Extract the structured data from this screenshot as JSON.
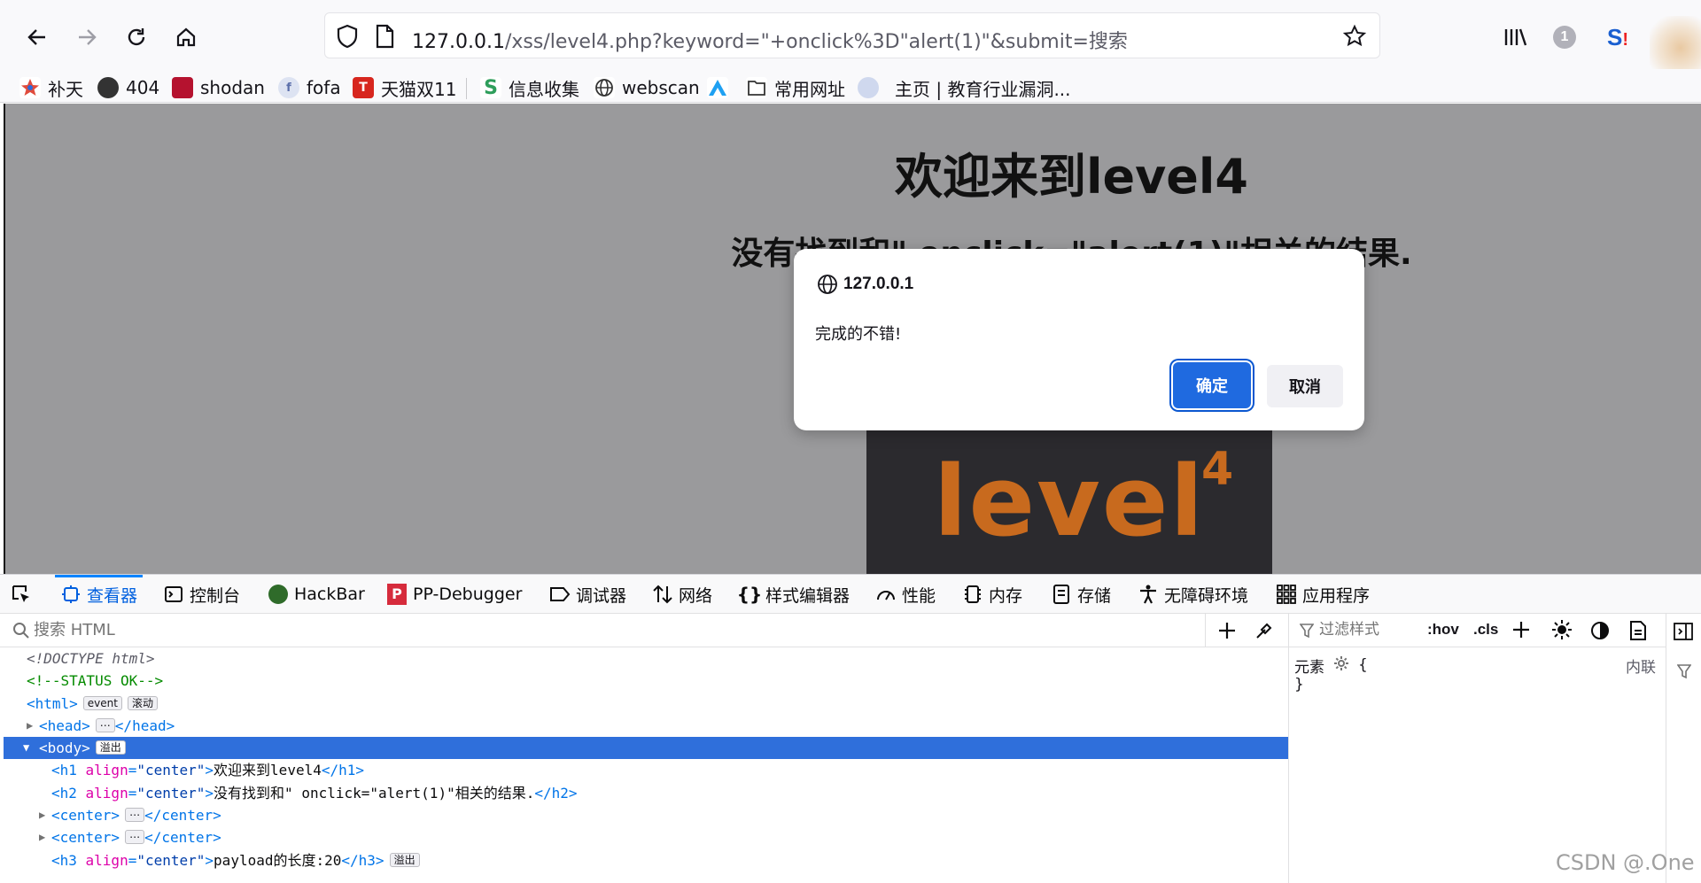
{
  "browser": {
    "url_host": "127.0.0.1",
    "url_path": "/xss/level4.php?keyword=\"+onclick%3D\"alert(1)\"&submit=搜索",
    "bookmarks": [
      {
        "label": "补天",
        "icon": "butian-icon",
        "color": "#d94a38"
      },
      {
        "label": "404",
        "icon": "404-icon",
        "color": "#333333"
      },
      {
        "label": "shodan",
        "icon": "shodan-icon",
        "color": "#b5122f"
      },
      {
        "label": "fofa",
        "icon": "fofa-icon",
        "color": "#5a6eaa"
      },
      {
        "label": "天猫双11",
        "icon": "tmall-icon",
        "color": "#d7261e"
      },
      {
        "label": "信息收集",
        "icon": "info-collect-icon",
        "color": "#2e9e5b"
      },
      {
        "label": "webscan",
        "icon": "globe-icon",
        "color": "#333333"
      },
      {
        "label": "",
        "icon": "triangle-icon",
        "color": "#1ea0f2"
      },
      {
        "label": "常用网址",
        "icon": "folder-icon",
        "color": "#333333"
      },
      {
        "label": "主页 | 教育行业漏洞...",
        "icon": "edusrc-icon",
        "color": "#6c86c9"
      }
    ]
  },
  "page": {
    "h1": "欢迎来到level4",
    "h2": "没有找到和\" onclick=\"alert(1)\"相关的结果.",
    "image_text": "level",
    "image_sup": "4"
  },
  "dialog": {
    "origin": "127.0.0.1",
    "message": "完成的不错!",
    "ok_label": "确定",
    "cancel_label": "取消"
  },
  "devtools": {
    "tabs": [
      {
        "label": "查看器",
        "icon": "inspector-icon"
      },
      {
        "label": "控制台",
        "icon": "console-icon"
      },
      {
        "label": "HackBar",
        "icon": "hackbar-icon"
      },
      {
        "label": "PP-Debugger",
        "icon": "ppdebugger-icon"
      },
      {
        "label": "调试器",
        "icon": "debugger-icon"
      },
      {
        "label": "网络",
        "icon": "network-icon"
      },
      {
        "label": "样式编辑器",
        "icon": "style-editor-icon"
      },
      {
        "label": "性能",
        "icon": "performance-icon"
      },
      {
        "label": "内存",
        "icon": "memory-icon"
      },
      {
        "label": "存储",
        "icon": "storage-icon"
      },
      {
        "label": "无障碍环境",
        "icon": "accessibility-icon"
      },
      {
        "label": "应用程序",
        "icon": "application-icon"
      }
    ],
    "search_placeholder": "搜索 HTML",
    "filter_placeholder": "过滤样式",
    "hov": ":hov",
    "cls": ".cls",
    "element_label": "元素",
    "brace_open": "{",
    "brace_close": "}",
    "inline_label": "内联",
    "markup": {
      "doctype": "<!DOCTYPE html>",
      "comment": "<!--STATUS OK-->",
      "html_tag": "<html>",
      "badge_event": "event",
      "badge_scroll": "滚动",
      "head_open": "<head>",
      "head_close": "</head>",
      "body_tag": "<body>",
      "badge_overflow": "溢出",
      "h1_attr": "align",
      "h1_val": "\"center\"",
      "h1_text": "欢迎来到level4",
      "h2_text": "没有找到和\" onclick=\"alert(1)\"相关的结果.",
      "center_open": "<center>",
      "center_close": "</center>",
      "h3_text": "payload的长度:20",
      "ellipsis": "⋯"
    }
  },
  "watermark": "CSDN @.One"
}
